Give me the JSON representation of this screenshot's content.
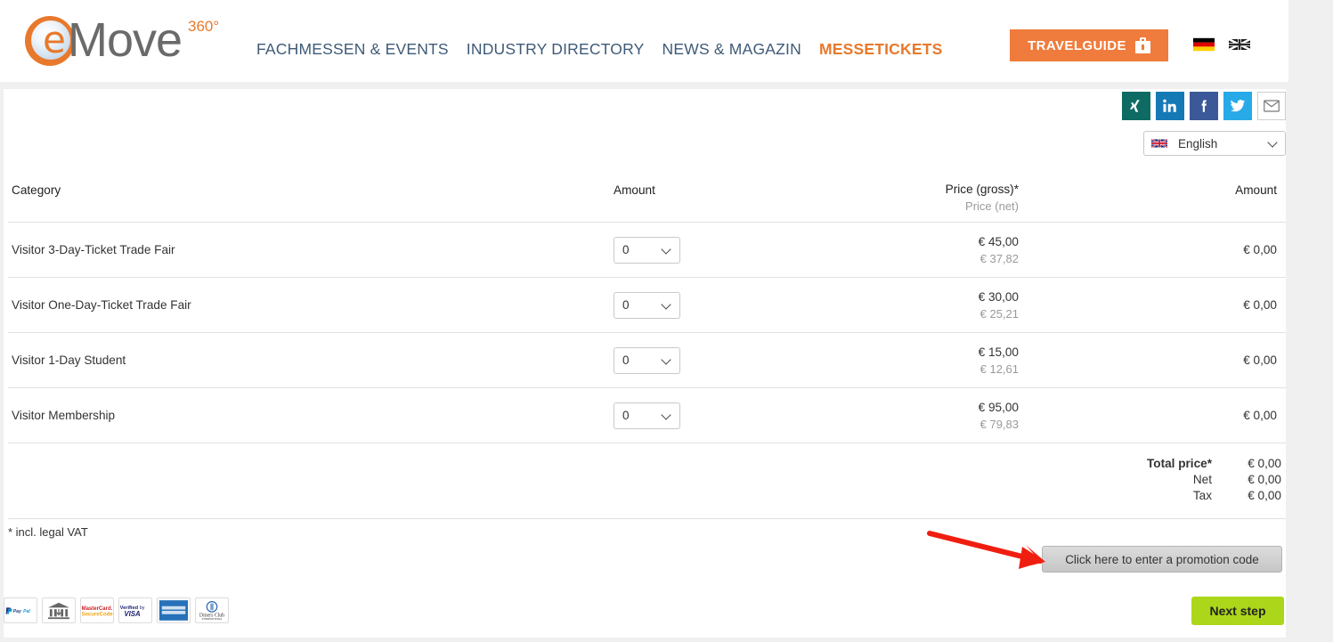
{
  "header": {
    "logo": {
      "mark": "e",
      "name": "Move",
      "sup": "360°"
    },
    "nav": [
      {
        "label": "FACHMESSEN & EVENTS",
        "active": false
      },
      {
        "label": "INDUSTRY DIRECTORY",
        "active": false
      },
      {
        "label": "NEWS & MAGAZIN",
        "active": false
      },
      {
        "label": "MESSETICKETS",
        "active": true
      }
    ],
    "travelguide_label": "TRAVELGUIDE",
    "travelguide_icon": "suitcase-icon",
    "flags": [
      {
        "name": "flag-de",
        "title": "Deutsch"
      },
      {
        "name": "flag-en",
        "title": "English"
      }
    ]
  },
  "social": [
    {
      "name": "xing",
      "glyph": "X",
      "color": "#0d6b63"
    },
    {
      "name": "linkedin",
      "glyph": "in",
      "color": "#1579b6"
    },
    {
      "name": "facebook",
      "glyph": "f",
      "color": "#3b5998"
    },
    {
      "name": "twitter",
      "glyph": "twitter-bird-icon",
      "color": "#28a9e8"
    },
    {
      "name": "email",
      "glyph": "envelope-icon",
      "color": "#ffffff"
    }
  ],
  "language": {
    "selected": "English",
    "flag": "flag-en",
    "chevron": "chevron-down-icon"
  },
  "table": {
    "headers": {
      "category": "Category",
      "amount": "Amount",
      "price_gross": "Price (gross)*",
      "price_net": "Price (net)",
      "total": "Amount"
    },
    "rows": [
      {
        "category": "Visitor 3-Day-Ticket Trade Fair",
        "qty": "0",
        "gross": "€ 45,00",
        "net": "€ 37,82",
        "amount": "€ 0,00"
      },
      {
        "category": "Visitor One-Day-Ticket Trade Fair",
        "qty": "0",
        "gross": "€ 30,00",
        "net": "€ 25,21",
        "amount": "€ 0,00"
      },
      {
        "category": "Visitor 1-Day Student",
        "qty": "0",
        "gross": "€ 15,00",
        "net": "€ 12,61",
        "amount": "€ 0,00"
      },
      {
        "category": "Visitor Membership",
        "qty": "0",
        "gross": "€ 95,00",
        "net": "€ 79,83",
        "amount": "€ 0,00"
      }
    ],
    "totals": [
      {
        "label": "Total price*",
        "value": "€ 0,00",
        "bold": true
      },
      {
        "label": "Net",
        "value": "€ 0,00",
        "bold": false
      },
      {
        "label": "Tax",
        "value": "€ 0,00",
        "bold": false
      }
    ]
  },
  "footer": {
    "vat_note": "* incl. legal VAT",
    "promo_label": "Click here to enter a promotion code",
    "next_label": "Next step",
    "payment_icons": [
      {
        "name": "paypal-icon",
        "label": "PayPal"
      },
      {
        "name": "sofort-bank-icon",
        "label": "Sofort"
      },
      {
        "name": "mastercard-securecode-icon",
        "label": "MasterCard SecureCode"
      },
      {
        "name": "verified-by-visa-icon",
        "label": "Verified by VISA"
      },
      {
        "name": "american-express-icon",
        "label": "American Express"
      },
      {
        "name": "diners-club-icon",
        "label": "Diners Club International"
      }
    ]
  },
  "annotation": {
    "arrow_color": "#f01e10",
    "arrow_target": "promotion-code-button"
  },
  "colors": {
    "brand_orange": "#e8792c",
    "nav_blue": "#3f5a77",
    "accent_green": "#acd61a",
    "panel": "#ffffff",
    "page_bg": "#f0f0f0"
  }
}
